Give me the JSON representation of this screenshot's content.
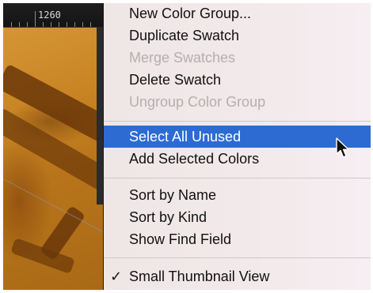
{
  "ruler": {
    "label": "1260"
  },
  "menu": {
    "items": [
      {
        "label": "New Color Group...",
        "enabled": true
      },
      {
        "label": "Duplicate Swatch",
        "enabled": true
      },
      {
        "label": "Merge Swatches",
        "enabled": false
      },
      {
        "label": "Delete Swatch",
        "enabled": true
      },
      {
        "label": "Ungroup Color Group",
        "enabled": false
      },
      {
        "label": "Select All Unused",
        "enabled": true,
        "highlighted": true
      },
      {
        "label": "Add Selected Colors",
        "enabled": true
      },
      {
        "label": "Sort by Name",
        "enabled": true
      },
      {
        "label": "Sort by Kind",
        "enabled": true
      },
      {
        "label": "Show Find Field",
        "enabled": true
      },
      {
        "label": "Small Thumbnail View",
        "enabled": true,
        "checked": true
      }
    ],
    "check_mark": "✓",
    "highlight_color": "#2d6bd3"
  }
}
